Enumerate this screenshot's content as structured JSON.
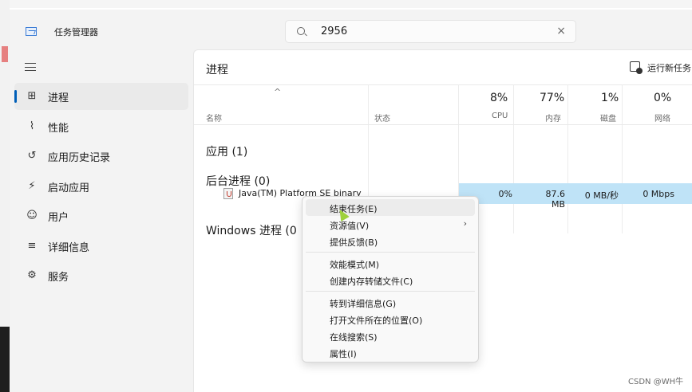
{
  "app": {
    "title": "任务管理器"
  },
  "search": {
    "value": "2956",
    "clear_icon": "×"
  },
  "sidebar": {
    "items": [
      {
        "label": "进程",
        "icon": "processes-icon",
        "glyph": "⊞",
        "active": true
      },
      {
        "label": "性能",
        "icon": "performance-icon",
        "glyph": "⌇",
        "active": false
      },
      {
        "label": "应用历史记录",
        "icon": "app-history-icon",
        "glyph": "↺",
        "active": false
      },
      {
        "label": "启动应用",
        "icon": "startup-icon",
        "glyph": "⚡",
        "active": false
      },
      {
        "label": "用户",
        "icon": "users-icon",
        "glyph": "☺",
        "active": false
      },
      {
        "label": "详细信息",
        "icon": "details-icon",
        "glyph": "≡",
        "active": false
      },
      {
        "label": "服务",
        "icon": "services-icon",
        "glyph": "⚙",
        "active": false
      }
    ]
  },
  "main": {
    "title": "进程",
    "run_new_task": "运行新任务",
    "columns": {
      "name": "名称",
      "status": "状态",
      "cpu": {
        "pct": "8%",
        "label": "CPU"
      },
      "memory": {
        "pct": "77%",
        "label": "内存"
      },
      "disk": {
        "pct": "1%",
        "label": "磁盘"
      },
      "network": {
        "pct": "0%",
        "label": "网络"
      }
    },
    "groups": {
      "apps": "应用 (1)",
      "background": "后台进程 (0)",
      "windows": "Windows 进程 (0"
    },
    "process": {
      "name": "Java(TM) Platform SE binary",
      "cpu": "0%",
      "memory": "87.6 MB",
      "disk": "0 MB/秒",
      "network": "0 Mbps"
    }
  },
  "context_menu": {
    "items": [
      {
        "label": "结束任务(E)",
        "hover": true
      },
      {
        "label": "资源值(V)",
        "submenu": true
      },
      {
        "label": "提供反馈(B)"
      },
      {
        "label": "效能模式(M)"
      },
      {
        "label": "创建内存转储文件(C)"
      },
      {
        "label": "转到详细信息(G)"
      },
      {
        "label": "打开文件所在的位置(O)"
      },
      {
        "label": "在线搜索(S)"
      },
      {
        "label": "属性(I)"
      }
    ],
    "submenu_arrow": "›"
  },
  "watermark": "CSDN @WH牛",
  "colors": {
    "accent": "#005fb8",
    "row_highlight": "#bfe3f7"
  }
}
